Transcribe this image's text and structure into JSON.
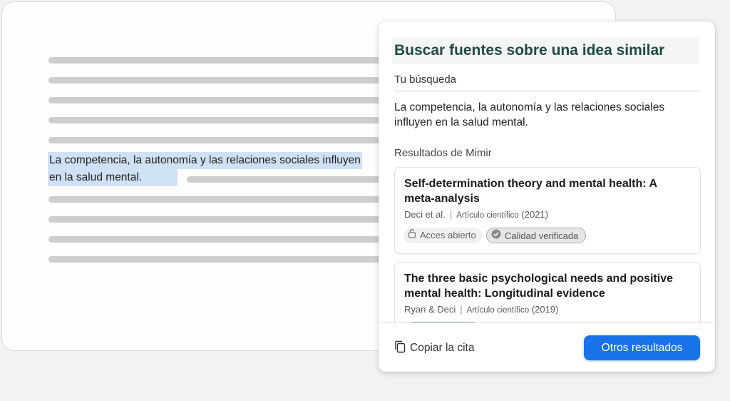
{
  "document": {
    "selected_text_lines": [
      "La competencia, la autonomía y las relaciones sociales influyen",
      "en la salud mental."
    ]
  },
  "panel": {
    "title": "Buscar fuentes sobre una idea similar",
    "query_label": "Tu búsqueda",
    "query_text": "La competencia, la autonomía y las relaciones sociales influyen en la salud mental.",
    "results_label": "Resultados de Mimir",
    "results": [
      {
        "title": "Self-determination theory and mental health: A meta-analysis",
        "authors": "Deci et al.",
        "type": "Artículo científico",
        "year": "(2021)",
        "badges": [
          {
            "label": "Acces abierto",
            "icon": "lock-open-icon"
          },
          {
            "label": "Calidad verificada",
            "icon": "check-circle-icon"
          }
        ]
      },
      {
        "title": "The three basic psychological needs and positive mental health: Longitudinal evidence",
        "authors": "Ryan & Deci",
        "type": "Artículo científico",
        "year": "(2019)"
      }
    ],
    "copy_label": "Copiar la cita",
    "copy_icon": "copy-icon",
    "primary_label": "Otros resultados"
  },
  "colors": {
    "title": "#1f4a44",
    "primary": "#1973e8",
    "selection": "#cfe1f4"
  }
}
